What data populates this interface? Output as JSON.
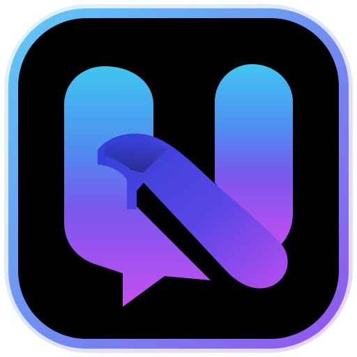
{
  "app_icon": {
    "glyph": "N",
    "icon_name": "n-chat-bubble-logo-icon",
    "colors": {
      "background": "#000000",
      "border_top_left": "#59c6f5",
      "border_bottom_right": "#8f55f0",
      "glyph_cyan": "#3fc0ee",
      "glyph_blue": "#4a4ce6",
      "glyph_violet": "#a84ff2",
      "glyph_pink": "#c64ff0"
    }
  }
}
